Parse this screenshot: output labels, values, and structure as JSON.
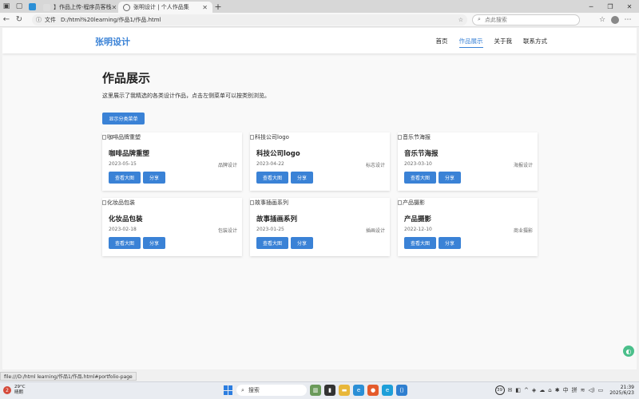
{
  "browser": {
    "tabs": [
      {
        "title": "】作品上传-程序员客栈",
        "active": false
      },
      {
        "title": "张明设计 | 个人作品集",
        "active": true
      }
    ],
    "address": {
      "scheme_label": "文件",
      "url": "D:/html%20learning/作品1/作品.html"
    },
    "search_placeholder": "点此搜索",
    "status_url": "file:///D:/html learning/作品1/作品.html#portfolio-page"
  },
  "site": {
    "logo": "张明设计",
    "nav": [
      {
        "label": "首页",
        "active": false
      },
      {
        "label": "作品展示",
        "active": true
      },
      {
        "label": "关于我",
        "active": false
      },
      {
        "label": "联系方式",
        "active": false
      }
    ],
    "page_title": "作品展示",
    "description": "这里展示了我精选的各类设计作品，点击左侧菜单可以按类别浏览。",
    "category_button": "显示分类菜单",
    "works": [
      {
        "image_alt": "咖啡品牌重塑",
        "title": "咖啡品牌重塑",
        "date": "2023-05-15",
        "category": "品牌设计",
        "view_label": "查看大图",
        "share_label": "分享"
      },
      {
        "image_alt": "科技公司logo",
        "title": "科技公司logo",
        "date": "2023-04-22",
        "category": "标志设计",
        "view_label": "查看大图",
        "share_label": "分享"
      },
      {
        "image_alt": "音乐节海报",
        "title": "音乐节海报",
        "date": "2023-03-10",
        "category": "海报设计",
        "view_label": "查看大图",
        "share_label": "分享"
      },
      {
        "image_alt": "化妆品包装",
        "title": "化妆品包装",
        "date": "2023-02-18",
        "category": "包装设计",
        "view_label": "查看大图",
        "share_label": "分享"
      },
      {
        "image_alt": "故事插画系列",
        "title": "故事插画系列",
        "date": "2023-01-25",
        "category": "插画设计",
        "view_label": "查看大图",
        "share_label": "分享"
      },
      {
        "image_alt": "产品摄影",
        "title": "产品摄影",
        "date": "2022-12-10",
        "category": "商业摄影",
        "view_label": "查看大图",
        "share_label": "分享"
      }
    ]
  },
  "taskbar": {
    "weather": {
      "temp": "29°C",
      "condition": "晴朗",
      "alert_count": "2"
    },
    "search_label": "搜索",
    "tray": {
      "notif_count": "39",
      "ime_lang": "中",
      "ime_mode": "拼"
    },
    "clock": {
      "time": "21:39",
      "date": "2025/6/23"
    }
  },
  "colors": {
    "accent": "#3a82d6",
    "page_bg": "#f9f9f9"
  }
}
